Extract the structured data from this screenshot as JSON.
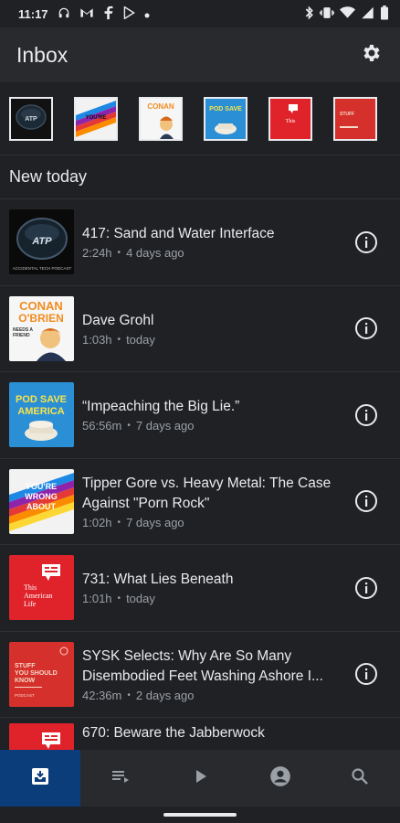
{
  "status": {
    "time": "11:17",
    "left_icons": [
      "headset-icon",
      "gmail-icon",
      "f-icon",
      "play-store-icon",
      "dot-icon"
    ],
    "right_icons": [
      "bluetooth-icon",
      "vibrate-icon",
      "wifi-icon",
      "signal-icon",
      "battery-icon"
    ]
  },
  "app_bar": {
    "title": "Inbox",
    "settings_icon": "gear-icon"
  },
  "carousel": {
    "items": [
      {
        "name": "atp",
        "bg": "#111111"
      },
      {
        "name": "youre-wrong-about",
        "bg": "#f2f2f2"
      },
      {
        "name": "conan-obrien",
        "bg": "#f6f6f6"
      },
      {
        "name": "pod-save-america",
        "bg": "#2b8fd6"
      },
      {
        "name": "this-american-life",
        "bg": "#e0232b"
      },
      {
        "name": "stuff-you-should-know",
        "bg": "#d6302c"
      }
    ]
  },
  "section": {
    "title": "New today"
  },
  "episodes": [
    {
      "title": "417: Sand and Water Interface",
      "duration": "2:24h",
      "age": "4 days ago",
      "art_bg": "#0a0a0a"
    },
    {
      "title": "Dave Grohl",
      "duration": "1:03h",
      "age": "today",
      "art_bg": "#f6f6f6"
    },
    {
      "title": "“Impeaching the Big Lie.”",
      "duration": "56:56m",
      "age": "7 days ago",
      "art_bg": "#2b8fd6"
    },
    {
      "title": "Tipper Gore vs. Heavy Metal: The Case Against \"Porn Rock\"",
      "duration": "1:02h",
      "age": "7 days ago",
      "art_bg": "#f2f2f2"
    },
    {
      "title": "731: What Lies Beneath",
      "duration": "1:01h",
      "age": "today",
      "art_bg": "#e0232b"
    },
    {
      "title": "SYSK Selects: Why Are So Many Disembodied Feet Washing Ashore I...",
      "duration": "42:36m",
      "age": "2 days ago",
      "art_bg": "#d6302c"
    },
    {
      "title": "670: Beware the Jabberwock",
      "duration": "",
      "age": "",
      "art_bg": "#e0232b"
    }
  ],
  "art_text": {
    "atp": "ATP",
    "atp_caption": "ACCIDENTAL TECH PODCAST",
    "conan_line1": "CONAN",
    "conan_line2": "O'BRIEN",
    "conan_line3": "NEEDS A",
    "conan_line4": "FRIEND",
    "psa_line1": "POD SAVE",
    "psa_line2": "AMERICA",
    "ywa_line1": "YOU'RE",
    "ywa_line2": "WRONG",
    "ywa_line3": "ABOUT",
    "tal_line1": "This",
    "tal_line2": "American",
    "tal_line3": "Life",
    "sysk_line1": "STUFF",
    "sysk_line2": "YOU SHOULD",
    "sysk_line3": "KNOW",
    "sysk_line4": "PODCAST"
  },
  "bottom_nav": [
    {
      "name": "nav-inbox",
      "icon": "inbox-icon",
      "active": true
    },
    {
      "name": "nav-queue",
      "icon": "queue-icon",
      "active": false
    },
    {
      "name": "nav-now-playing",
      "icon": "play-icon",
      "active": false
    },
    {
      "name": "nav-profile",
      "icon": "account-icon",
      "active": false
    },
    {
      "name": "nav-search",
      "icon": "search-icon",
      "active": false
    }
  ],
  "colors": {
    "accent": "#0b3d7a",
    "background": "#202124",
    "surface": "#282a2d",
    "secondary_text": "#9aa0a6"
  }
}
